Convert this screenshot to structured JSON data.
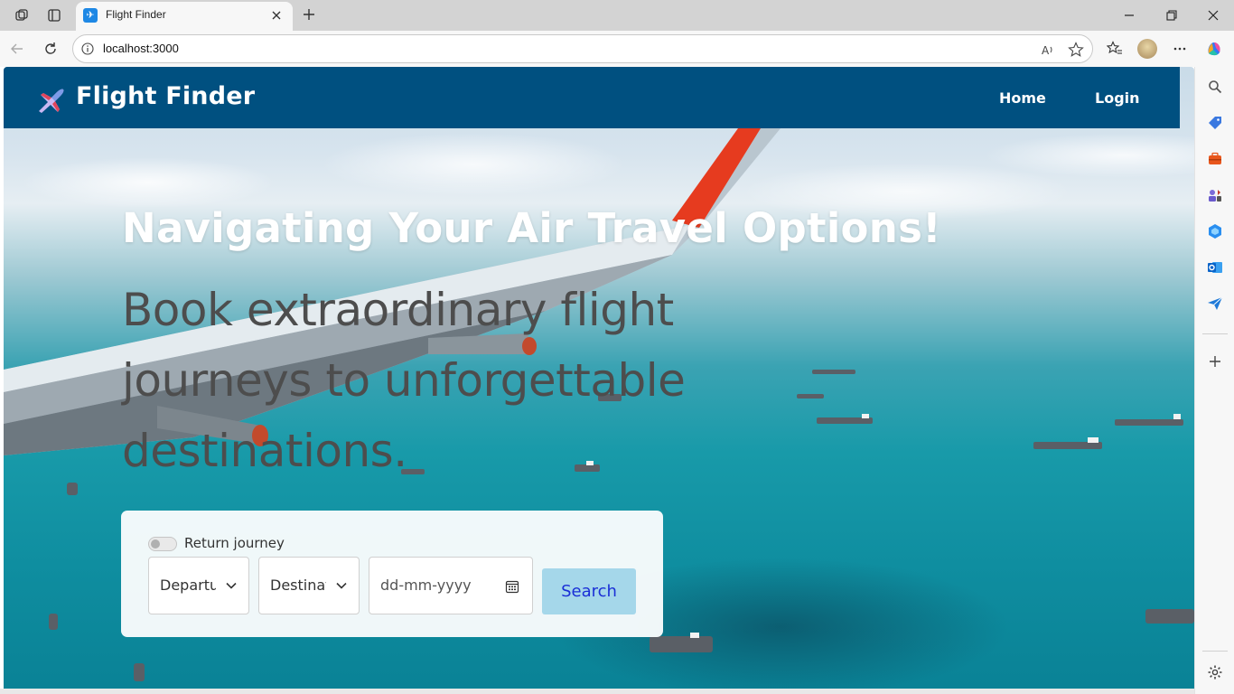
{
  "browser": {
    "tab_title": "Flight Finder",
    "url": "localhost:3000"
  },
  "navbar": {
    "brand": "Flight Finder",
    "links": [
      "Home",
      "Login"
    ]
  },
  "hero": {
    "title": "Navigating Your Air Travel Options!",
    "subtitle": "Book extraordinary flight journeys to unforgettable destinations."
  },
  "search": {
    "return_label": "Return journey",
    "return_enabled": false,
    "departure_placeholder": "Departure City",
    "destination_placeholder": "Destination City",
    "date_placeholder": "dd-mm-yyyy",
    "button": "Search"
  },
  "colors": {
    "navbar": "#005080",
    "search_button": "#a5d7ea",
    "search_button_text": "#1a2fd6",
    "subtitle_text": "#4d4d4d"
  }
}
